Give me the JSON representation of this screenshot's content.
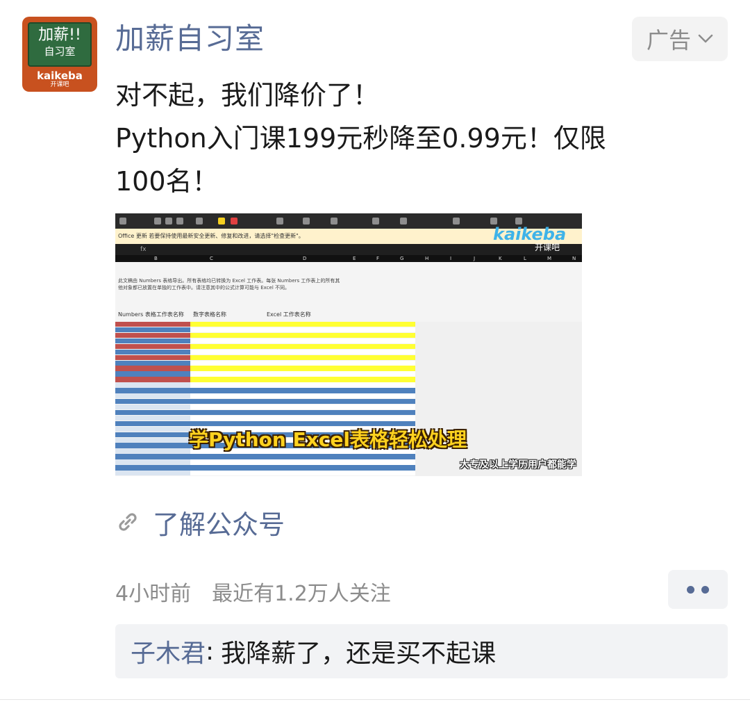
{
  "account": {
    "name": "加薪自习室",
    "avatar_board_line1": "加薪!!",
    "avatar_board_line2": "自习室",
    "avatar_brand": "kaikeba",
    "avatar_brand_sub": "开课吧"
  },
  "ad_badge": {
    "label": "广告",
    "icon": "chevron-down-icon"
  },
  "ad_text": {
    "line1": "对不起，我们降价了！",
    "line2": "Python入门课199元秒降至0.99元！仅限",
    "line3": "100名！"
  },
  "ad_image": {
    "office_notice": "Office 更新  若要保持使用最新安全更新、修复和改进，请选择\"检查更新\"。",
    "formula_symbol": "fx",
    "column_letters": [
      "B",
      "C",
      "D",
      "E",
      "F",
      "G",
      "H",
      "I",
      "J",
      "K",
      "L",
      "M",
      "N"
    ],
    "description": "此文稿由 Numbers 表格导出。所有表格均已转换为 Excel 工作表。每张 Numbers 工作表上的所有其他对象都已放置在单独的工作表中。请注意其中的公式计算可能与 Excel 不同。",
    "header_numbers_sheet": "Numbers 表格工作表名称",
    "header_numbers_table": "数字表格名称",
    "header_excel_sheet": "Excel 工作表名称",
    "logo_text": "kaikeba",
    "logo_sub": "开课吧",
    "caption": "学Python Excel表格轻松处理",
    "subcaption": "大专及以上学历用户都能学"
  },
  "link": {
    "label": "了解公众号",
    "icon": "link-icon"
  },
  "meta": {
    "time": "4小时前",
    "followers": "最近有1.2万人关注"
  },
  "more_button": {
    "icon": "more-dots-icon"
  },
  "comment": {
    "user": "子木君",
    "separator": ":",
    "text": "我降薪了，还是买不起课"
  },
  "colors": {
    "link_blue": "#576b95",
    "text": "#1a1a1a",
    "muted": "#8c8c8c",
    "comment_bg": "#f2f3f5"
  }
}
